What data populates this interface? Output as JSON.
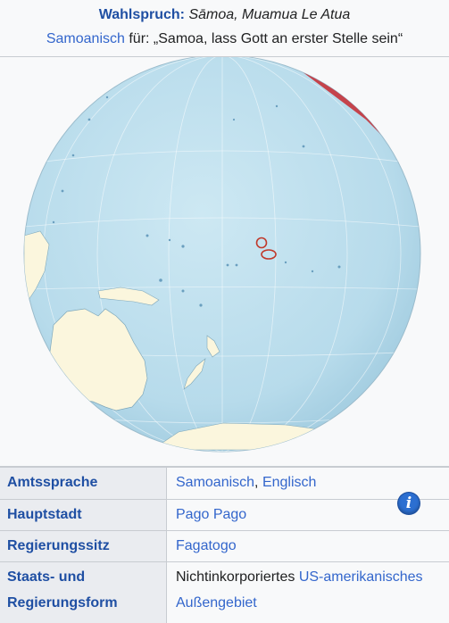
{
  "motto": {
    "label": "Wahlspruch:",
    "text": "Sāmoa, Muamua Le Atua",
    "lang_link": "Samoanisch",
    "translation": " für: „Samoa, lass Gott an erster Stelle sein“"
  },
  "map": {
    "info_icon": "i",
    "colors": {
      "ocean": "#bfe0ee",
      "land": "#fbf6dd",
      "highlight": "#c7323a",
      "samoa_ring": "#c0392b"
    }
  },
  "rows": [
    {
      "key": "Amtssprache",
      "parts": [
        {
          "text": "Samoanisch",
          "link": true
        },
        {
          "text": ", ",
          "link": false
        },
        {
          "text": "Englisch",
          "link": true
        }
      ]
    },
    {
      "key": "Hauptstadt",
      "parts": [
        {
          "text": "Pago Pago",
          "link": true
        }
      ]
    },
    {
      "key": "Regierungssitz",
      "parts": [
        {
          "text": "Fagatogo",
          "link": true
        }
      ]
    },
    {
      "key": "Staats- und Regierungsform",
      "parts": [
        {
          "text": "Nichtinkorporiertes ",
          "link": false
        },
        {
          "text": "US-amerikanisches",
          "link": true
        },
        {
          "text": " Außengebiet",
          "link": true
        }
      ]
    }
  ]
}
